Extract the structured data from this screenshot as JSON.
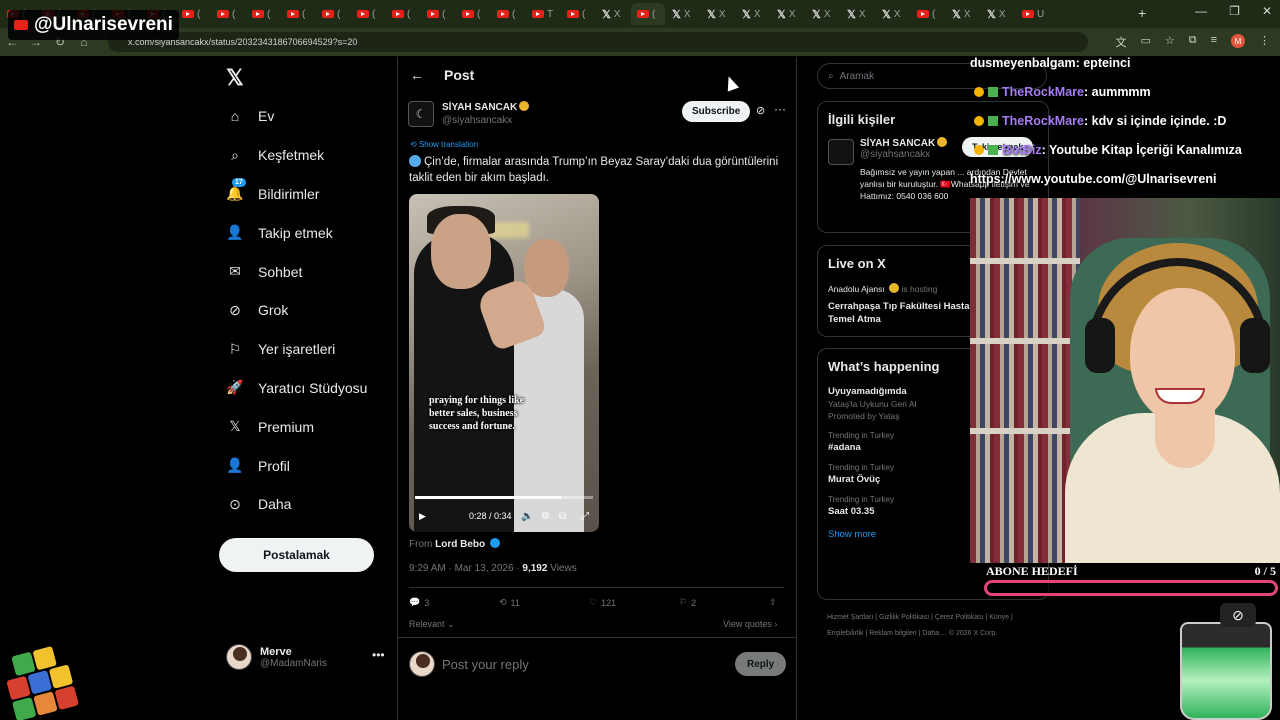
{
  "overlay": {
    "channel": "@Ulnarisevreni"
  },
  "browser": {
    "url": "x.com/siyahsancakx/status/2032343186706694529?s=20",
    "tab_labels": [
      "(",
      "(",
      "(",
      "(",
      "(",
      "(",
      "(",
      "(",
      "(",
      "(",
      "(",
      "(",
      "(",
      "(",
      "(",
      "T",
      "(",
      "X",
      "(",
      "X",
      "X",
      "X",
      "X",
      "X",
      "X",
      "X",
      "(",
      "X",
      "X",
      "U"
    ],
    "profile_initial": "M"
  },
  "sidebar": {
    "items": [
      {
        "label": "Ev",
        "icon": "home-icon"
      },
      {
        "label": "Keşfetmek",
        "icon": "search-icon"
      },
      {
        "label": "Bildirimler",
        "icon": "bell-icon",
        "badge": "17"
      },
      {
        "label": "Takip etmek",
        "icon": "person-add-icon"
      },
      {
        "label": "Sohbet",
        "icon": "mail-icon"
      },
      {
        "label": "Grok",
        "icon": "grok-icon"
      },
      {
        "label": "Yer işaretleri",
        "icon": "bookmark-icon"
      },
      {
        "label": "Yaratıcı Stüdyosu",
        "icon": "rocket-icon"
      },
      {
        "label": "Premium",
        "icon": "x-icon"
      },
      {
        "label": "Profil",
        "icon": "profile-icon"
      },
      {
        "label": "Daha",
        "icon": "more-circle-icon"
      }
    ],
    "post_button": "Postalamak",
    "account": {
      "name": "Merve",
      "handle": "@MadamNaris"
    }
  },
  "post": {
    "header": "Post",
    "author": {
      "name": "SİYAH SANCAK",
      "handle": "@siyahsancakx"
    },
    "subscribe": "Subscribe",
    "show_translation": "Show translation",
    "text": "Çin’de, firmalar arasında Trump’ın Beyaz Saray’daki dua görüntülerini taklit eden bir akım başladı.",
    "video": {
      "caption": "praying for things like better sales, business success and fortune.",
      "time": "0:28 / 0:34",
      "progress": 0.82
    },
    "from_label": "From",
    "from_name": "Lord Bebo",
    "timestamp": "9:29 AM · Mar 13, 2026 · ",
    "views_count": "9,192",
    "views_label": " Views",
    "stats": {
      "replies": "3",
      "reposts": "11",
      "likes": "121",
      "bookmarks": "2"
    },
    "relevant": "Relevant ⌄",
    "view_quotes": "View quotes ›",
    "reply_placeholder": "Post your reply",
    "reply_button": "Reply"
  },
  "right": {
    "search_placeholder": "Aramak",
    "related": {
      "title": "İlgili kişiler",
      "name": "SİYAH SANCAK",
      "handle": "@siyahsancakx",
      "follow": "Takip etmek",
      "bio": "Bağımsız ve yayın yapan ... ardından Devlet yanlısı bir kuruluştur. 🇹🇷Whatsapp İletişim ve Hattımız: 0540 036 600"
    },
    "live": {
      "title": "Live on X",
      "host": "Anadolu Ajansı",
      "host_suffix": "is hosting",
      "space_title": "Cerrahpaşa Tıp Fakültesi Hastanesi 1. Etap Temel Atma"
    },
    "happening": {
      "title": "What’s happening",
      "trends": [
        {
          "context": "",
          "title": "Uyuyamadığımda",
          "sub": "Yataş'la Uykunu Geri Al",
          "promo": "Promoted by Yataş"
        },
        {
          "context": "Trending in Turkey",
          "title": "#adana",
          "sub": "",
          "promo": ""
        },
        {
          "context": "Trending in Turkey",
          "title": "Murat Övüç",
          "sub": "",
          "promo": ""
        },
        {
          "context": "Trending in Turkey",
          "title": "Saat 03.35",
          "sub": "",
          "promo": ""
        }
      ],
      "show_more": "Show more"
    },
    "footer": "Hizmet Şartları  |  Gizlilik Politikası  |  Çerez Politikası  |  Künye  |  Erişilebilirlik  |  Reklam bilgileri  |  Daha ...  © 2026 X Corp."
  },
  "chat": [
    {
      "user": "",
      "text": "dusmeyenbalgam: epteinci"
    },
    {
      "user": "TheRockMare",
      "text": ": aummmm"
    },
    {
      "user": "TheRockMare",
      "text": ": kdv si içinde içinde. :D"
    },
    {
      "user": "BotBiz",
      "text": ": Youtube Kitap İçeriği Kanalımıza"
    },
    {
      "user": "",
      "text": "https://www.youtube.com/@Ulnarisevreni"
    }
  ],
  "goal": {
    "label": "ABONE HEDEFİ",
    "current": "0",
    "separator": " / ",
    "target": "5",
    "progress": 0
  }
}
